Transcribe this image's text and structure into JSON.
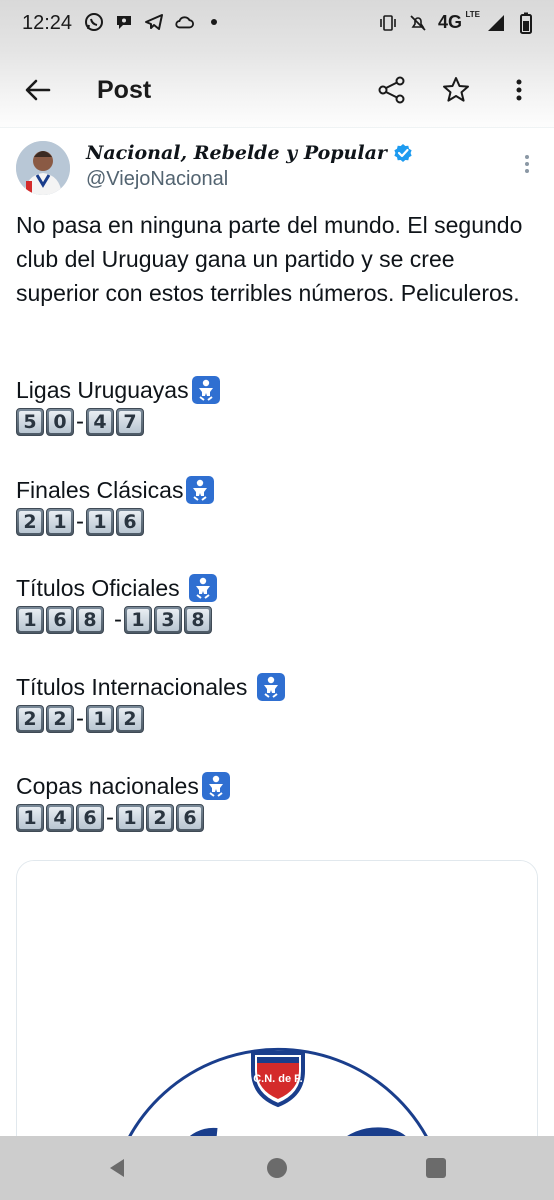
{
  "status_bar": {
    "time": "12:24",
    "network": "4G",
    "network_sup": "LTE",
    "left_icons": [
      "whatsapp-icon",
      "chat-icon",
      "telegram-icon",
      "cloud-icon",
      "dot-icon"
    ],
    "right_icons": [
      "vibrate-icon",
      "mute-icon",
      "signal-icon",
      "battery-icon"
    ]
  },
  "app_bar": {
    "title": "Post",
    "actions": [
      "share-icon",
      "star-icon",
      "more-vertical-icon"
    ]
  },
  "tweet": {
    "display_name": "Nacional, Rebelde y Popular",
    "handle": "@ViejoNacional",
    "verified": true,
    "text": "No pasa en ninguna parte del mundo. El segundo club del Uruguay gana un partido y se cree superior con estos terribles números. Peliculeros.",
    "stats": [
      {
        "label": "Ligas Uruguayas",
        "left": [
          "5",
          "0"
        ],
        "right": [
          "4",
          "7"
        ],
        "spaced_dash": false
      },
      {
        "label": "Finales Clásicas",
        "left": [
          "2",
          "1"
        ],
        "right": [
          "1",
          "6"
        ],
        "spaced_dash": false
      },
      {
        "label": "Títulos Oficiales ",
        "left": [
          "1",
          "6",
          "8"
        ],
        "right": [
          "1",
          "3",
          "8"
        ],
        "spaced_dash": true
      },
      {
        "label": "Títulos Internacionales ",
        "left": [
          "2",
          "2"
        ],
        "right": [
          "1",
          "2"
        ],
        "spaced_dash": false
      },
      {
        "label": "Copas nacionales",
        "left": [
          "1",
          "4",
          "6"
        ],
        "right": [
          "1",
          "2",
          "6"
        ],
        "spaced_dash": false
      }
    ],
    "dash": "-",
    "media": {
      "crest_text": "C.N. de F."
    }
  },
  "colors": {
    "verified_blue": "#1d9bf0",
    "crest_blue": "#1a3e8c",
    "crest_red": "#d42b2b",
    "baby_icon_bg": "#2f6fd1"
  },
  "nav_bar": {
    "buttons": [
      "nav-back-icon",
      "nav-home-icon",
      "nav-recents-icon"
    ]
  }
}
